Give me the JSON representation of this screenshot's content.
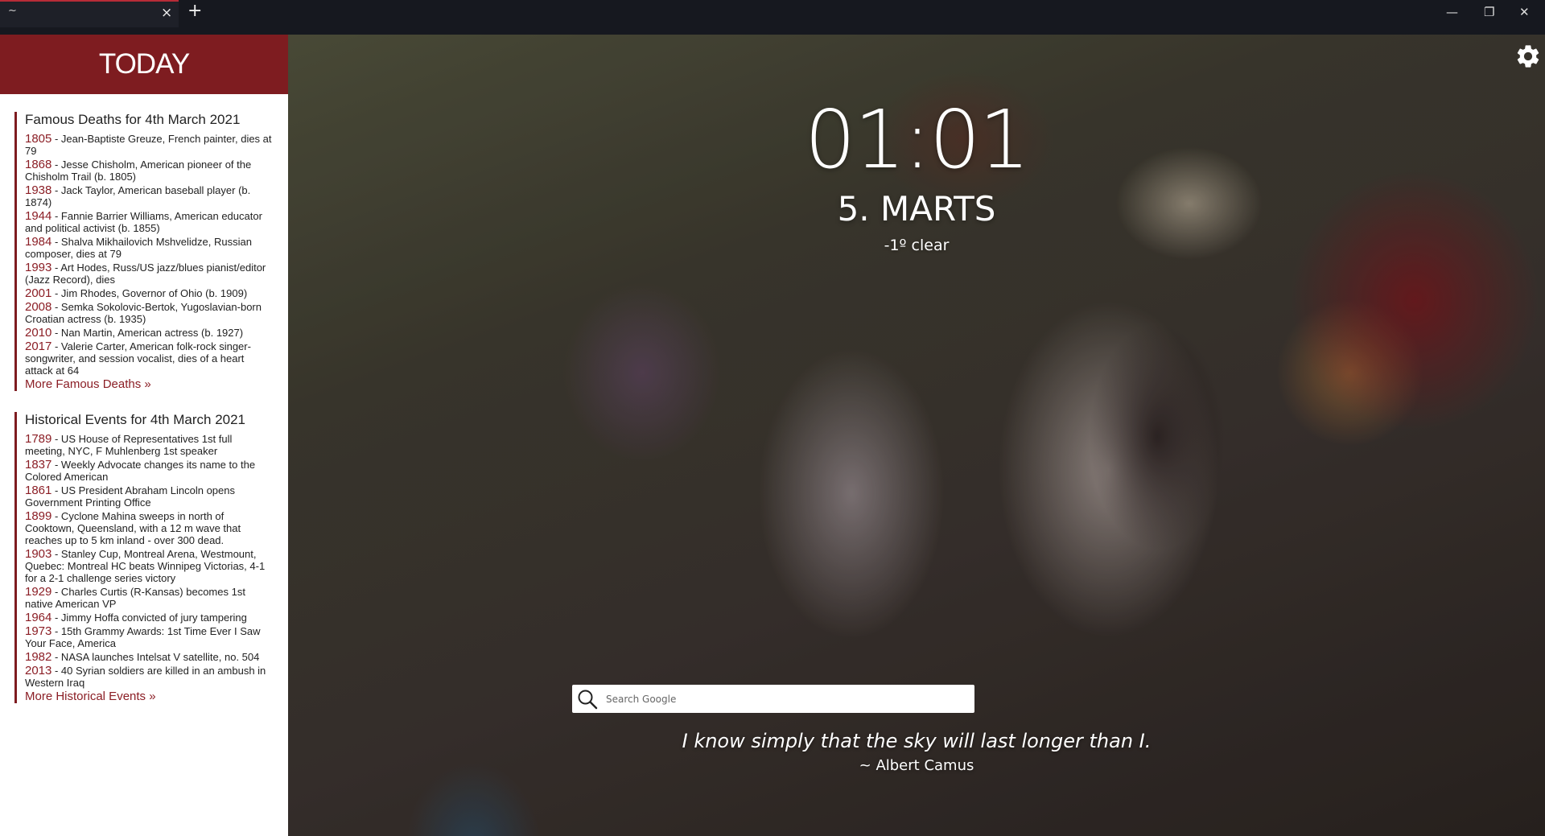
{
  "browser": {
    "tab_title": "~",
    "tab_close": "×",
    "new_tab": "+",
    "minimize": "—",
    "restore": "❐",
    "close": "✕"
  },
  "sidebar": {
    "title": "TODAY",
    "deaths": {
      "heading": "Famous Deaths for 4th March 2021",
      "items": [
        {
          "year": "1805",
          "text": " - Jean-Baptiste Greuze, French painter, dies at 79"
        },
        {
          "year": "1868",
          "text": " - Jesse Chisholm, American pioneer of the Chisholm Trail (b. 1805)"
        },
        {
          "year": "1938",
          "text": " - Jack Taylor, American baseball player (b. 1874)"
        },
        {
          "year": "1944",
          "text": " - Fannie Barrier Williams, American educator and political activist (b. 1855)"
        },
        {
          "year": "1984",
          "text": " - Shalva Mikhailovich Mshvelidze, Russian composer, dies at 79"
        },
        {
          "year": "1993",
          "text": " - Art Hodes, Russ/US jazz/blues pianist/editor (Jazz Record), dies"
        },
        {
          "year": "2001",
          "text": " - Jim Rhodes, Governor of Ohio (b. 1909)"
        },
        {
          "year": "2008",
          "text": " - Semka Sokolovic-Bertok, Yugoslavian-born Croatian actress (b. 1935)"
        },
        {
          "year": "2010",
          "text": " - Nan Martin, American actress (b. 1927)"
        },
        {
          "year": "2017",
          "text": " - Valerie Carter, American folk-rock singer-songwriter, and session vocalist, dies of a heart attack at 64"
        }
      ],
      "more": "More Famous Deaths »"
    },
    "events": {
      "heading": "Historical Events for 4th March 2021",
      "items": [
        {
          "year": "1789",
          "text": " - US House of Representatives 1st full meeting, NYC, F Muhlenberg 1st speaker"
        },
        {
          "year": "1837",
          "text": " - Weekly Advocate changes its name to the Colored American"
        },
        {
          "year": "1861",
          "text": " - US President Abraham Lincoln opens Government Printing Office"
        },
        {
          "year": "1899",
          "text": " - Cyclone Mahina sweeps in north of Cooktown, Queensland, with a 12 m wave that reaches up to 5 km inland - over 300 dead."
        },
        {
          "year": "1903",
          "text": " - Stanley Cup, Montreal Arena, Westmount, Quebec: Montreal HC beats Winnipeg Victorias, 4-1 for a 2-1 challenge series victory"
        },
        {
          "year": "1929",
          "text": " - Charles Curtis (R-Kansas) becomes 1st native American VP"
        },
        {
          "year": "1964",
          "text": " - Jimmy Hoffa convicted of jury tampering"
        },
        {
          "year": "1973",
          "text": " - 15th Grammy Awards: 1st Time Ever I Saw Your Face, America"
        },
        {
          "year": "1982",
          "text": " - NASA launches Intelsat V satellite, no. 504"
        },
        {
          "year": "2013",
          "text": " - 40 Syrian soldiers are killed in an ambush in Western Iraq"
        }
      ],
      "more": "More Historical Events »"
    }
  },
  "main": {
    "time": "01:01",
    "date": "5. MARTS",
    "weather": "-1º clear",
    "search": {
      "placeholder": "Search Google",
      "value": ""
    },
    "quote": "I know simply that the sky will last longer than I.",
    "author": "~ Albert Camus",
    "icons": {
      "settings": "gear-icon",
      "search": "search-icon"
    }
  },
  "colors": {
    "accent": "#7e1c20",
    "year": "#8b1e25",
    "titlebar": "#16181f"
  }
}
